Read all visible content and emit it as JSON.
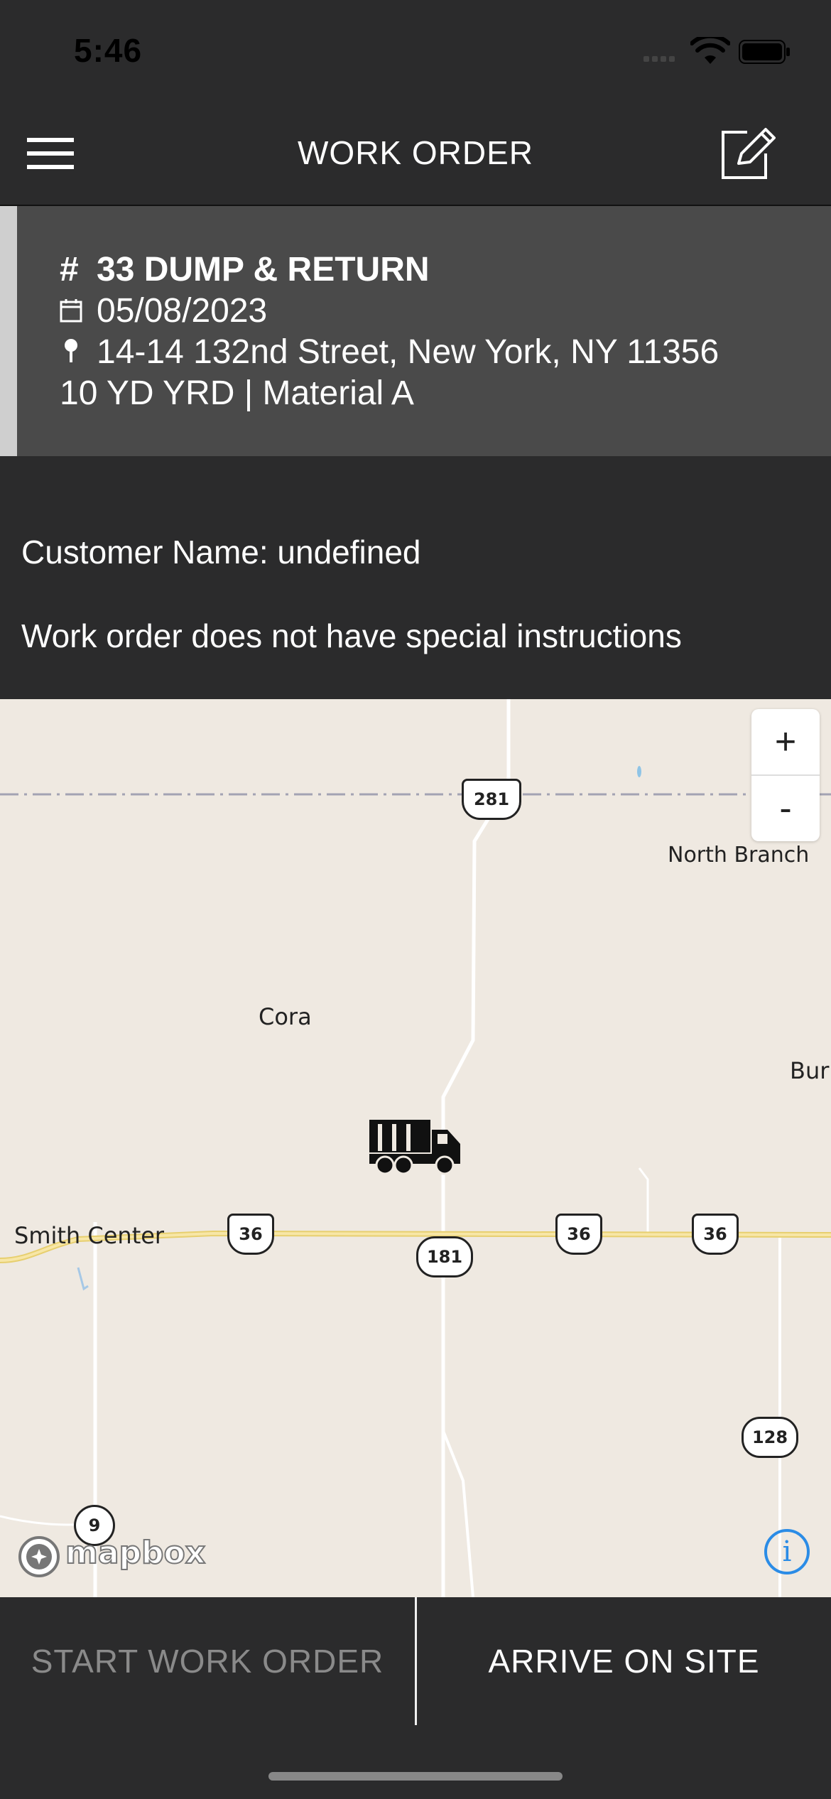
{
  "status": {
    "time": "5:46"
  },
  "header": {
    "title": "WORK ORDER",
    "menu_icon": "hamburger-icon",
    "edit_icon": "edit-icon"
  },
  "order": {
    "number_symbol": "#",
    "title": "33 DUMP & RETURN",
    "date": "05/08/2023",
    "address": "14-14 132nd Street, New York, NY 11356",
    "details": "10 YD YRD | Material A"
  },
  "info": {
    "customer": "Customer Name: undefined",
    "instructions": "Work order does not have special instructions"
  },
  "map": {
    "labels": {
      "north_branch": "North Branch",
      "cora": "Cora",
      "bur": "Bur",
      "smith_center": "Smith Center"
    },
    "shields": {
      "us281": "281",
      "us36_a": "36",
      "us36_b": "36",
      "us36_c": "36",
      "r181": "181",
      "r128": "128",
      "r9": "9"
    },
    "zoom_in": "+",
    "zoom_out": "-",
    "attribution": "mapbox",
    "info_icon": "i",
    "colors": {
      "land": "#efe9e1",
      "highway": "#f3d98a",
      "road": "#ffffff",
      "border": "#a3a3b3"
    }
  },
  "actions": {
    "start": "START WORK ORDER",
    "arrive": "ARRIVE ON SITE"
  }
}
